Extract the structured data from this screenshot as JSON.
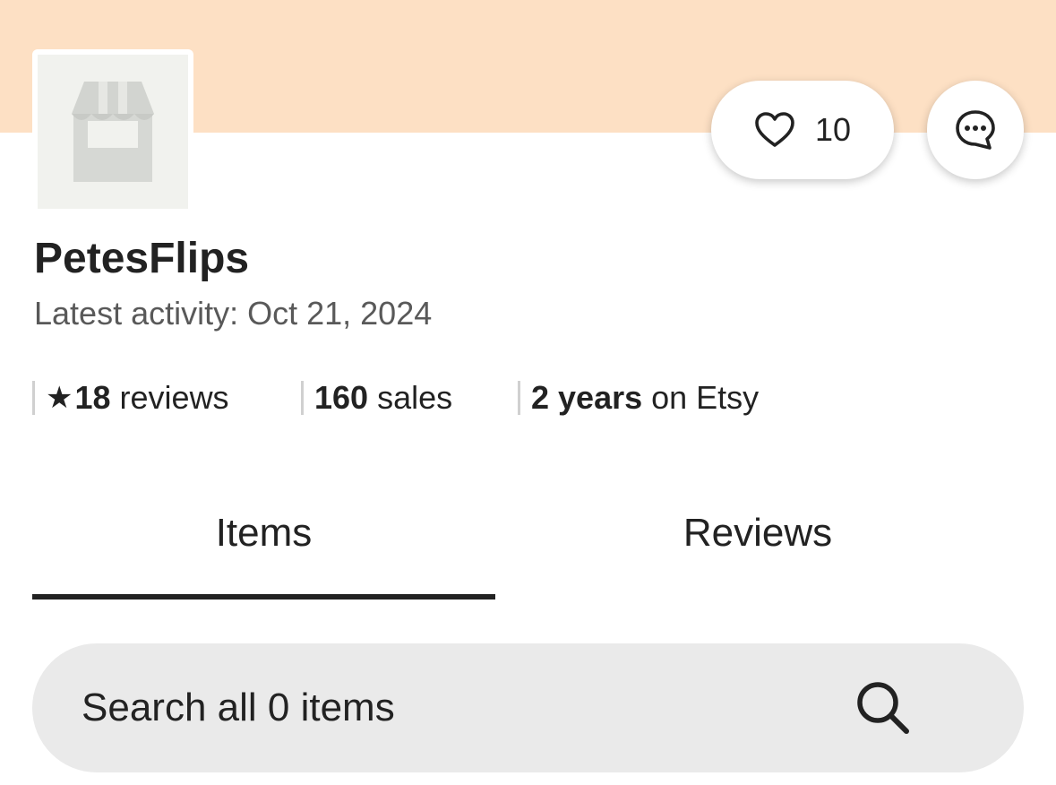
{
  "shop": {
    "name": "PetesFlips",
    "activity": "Latest activity: Oct 21, 2024",
    "favorites_count": "10"
  },
  "stats": {
    "reviews_star": "★",
    "reviews_count": "18",
    "reviews_label": " reviews",
    "sales_count": "160",
    "sales_label": " sales",
    "years_value": "2 years",
    "years_label": " on Etsy"
  },
  "tabs": [
    {
      "label": "Items",
      "active": true
    },
    {
      "label": "Reviews",
      "active": false
    }
  ],
  "search": {
    "placeholder": "Search all 0 items"
  },
  "icons": {
    "favorite": "heart-icon",
    "message": "chat-bubble-icon",
    "search": "search-icon",
    "avatar": "storefront-icon"
  },
  "colors": {
    "banner": "#fde0c4",
    "text": "#222222",
    "muted": "#595959",
    "search_bg": "#eaeaea"
  }
}
